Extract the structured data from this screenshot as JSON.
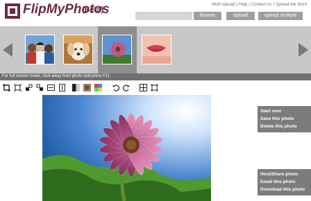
{
  "header": {
    "logo_text": "FlipMyPhotos",
    "logo_beta": "(Beta)",
    "links": [
      "Multi Upload",
      "Help",
      "Contact Us",
      "Spread the Word"
    ],
    "separator": "|",
    "browse_label": "browse",
    "upload_label": "upload",
    "upload_multiple_label": "upload multiple"
  },
  "thumbnails": [
    {
      "name": "children-group-photo",
      "selected": false
    },
    {
      "name": "white-puppy-photo",
      "selected": false
    },
    {
      "name": "pink-daisy-photo",
      "selected": true
    },
    {
      "name": "pink-lips-photo",
      "selected": false
    }
  ],
  "info": {
    "fullscreen_hint": "For full screen mode, click away from photo and press F11"
  },
  "toolbar": {
    "tools": [
      "crop-icon",
      "resize-icon",
      "rotate-left-icon",
      "rotate-right-icon",
      "flip-horizontal-icon",
      "flip-vertical-icon",
      "grayscale-icon",
      "sepia-icon",
      "color-icon",
      "undo-icon",
      "redo-icon",
      "fit-screen-icon",
      "actual-size-icon"
    ]
  },
  "menu_top": {
    "items": [
      "Start over",
      "Save this photo",
      "Delete this photo"
    ]
  },
  "menu_bottom": {
    "items": [
      "Host/Share photo",
      "Email this photo",
      "Download this photo"
    ]
  },
  "colors": {
    "brand": "#6a2a44",
    "strip": "#c8c8c8",
    "selected": "#8e8e8e",
    "menu": "#7c7c7c"
  }
}
